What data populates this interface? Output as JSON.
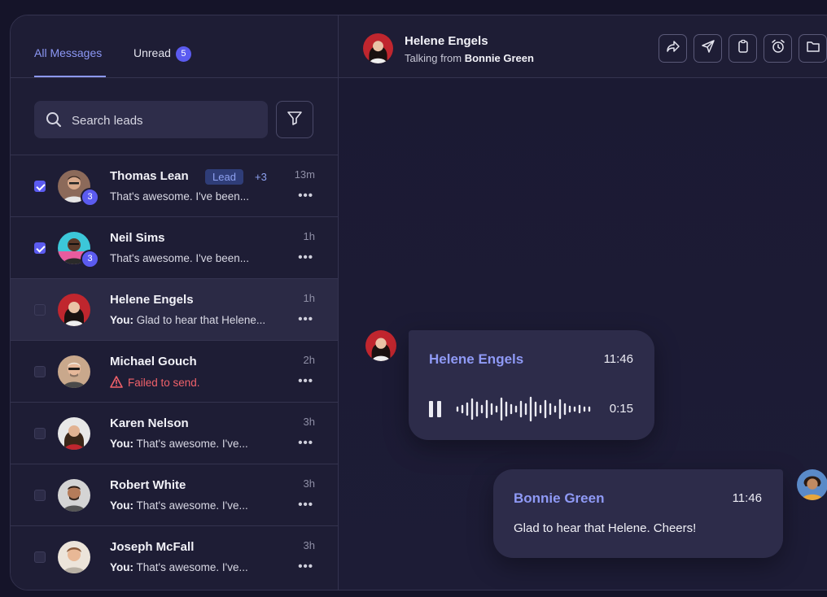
{
  "tabs": {
    "all": "All Messages",
    "unread": "Unread",
    "unread_count": "5"
  },
  "search": {
    "placeholder": "Search leads"
  },
  "conversations": [
    {
      "name": "Thomas Lean",
      "badge": "Lead",
      "extra": "+3",
      "time": "13m",
      "preview": "That's awesome. I've been...",
      "checked": true,
      "count": "3"
    },
    {
      "name": "Neil Sims",
      "time": "1h",
      "preview": "That's awesome. I've been...",
      "checked": true,
      "count": "3"
    },
    {
      "name": "Helene Engels",
      "time": "1h",
      "you": "You:",
      "preview": " Glad to hear that Helene...",
      "checked": false,
      "selected": true
    },
    {
      "name": "Michael Gouch",
      "time": "2h",
      "preview": "Failed to send.",
      "error": true,
      "checked": false
    },
    {
      "name": "Karen Nelson",
      "time": "3h",
      "you": "You:",
      "preview": " That's awesome. I've...",
      "checked": false
    },
    {
      "name": "Robert White",
      "time": "3h",
      "you": "You:",
      "preview": " That's awesome. I've...",
      "checked": false
    },
    {
      "name": "Joseph McFall",
      "time": "3h",
      "you": "You:",
      "preview": " That's awesome. I've...",
      "checked": false
    }
  ],
  "more_label": "•••",
  "header": {
    "name": "Helene Engels",
    "sub_prefix": "Talking from",
    "sub_name": "Bonnie Green"
  },
  "tools": [
    "share-icon",
    "send-icon",
    "clipboard-icon",
    "alarm-icon",
    "folder-icon"
  ],
  "messages": {
    "voice": {
      "sender": "Helene Engels",
      "time": "11:46",
      "duration": "0:15"
    },
    "text": {
      "sender": "Bonnie Green",
      "time": "11:46",
      "body": "Glad to hear that Helene. Cheers!"
    }
  },
  "colors": {
    "accent": "#5b5bf0",
    "link": "#8c98f5",
    "error": "#f0616a",
    "panel": "#1e1d35"
  }
}
